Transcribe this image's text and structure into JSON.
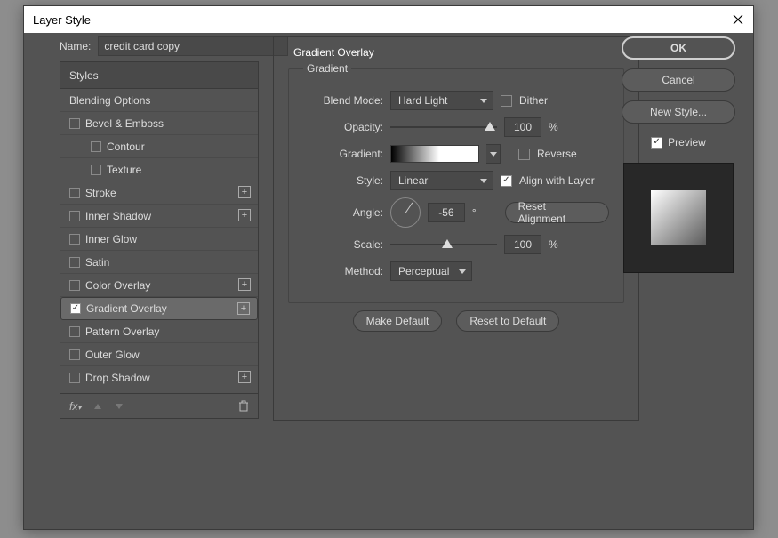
{
  "window": {
    "title": "Layer Style"
  },
  "name": {
    "label": "Name:",
    "value": "credit card copy"
  },
  "styles": {
    "header": "Styles",
    "blending": "Blending Options",
    "items": [
      {
        "label": "Bevel & Emboss",
        "checked": false,
        "add": false
      },
      {
        "label": "Contour",
        "checked": false,
        "add": false
      },
      {
        "label": "Texture",
        "checked": false,
        "add": false
      },
      {
        "label": "Stroke",
        "checked": false,
        "add": true
      },
      {
        "label": "Inner Shadow",
        "checked": false,
        "add": true
      },
      {
        "label": "Inner Glow",
        "checked": false,
        "add": false
      },
      {
        "label": "Satin",
        "checked": false,
        "add": false
      },
      {
        "label": "Color Overlay",
        "checked": false,
        "add": true
      },
      {
        "label": "Gradient Overlay",
        "checked": true,
        "add": true
      },
      {
        "label": "Pattern Overlay",
        "checked": false,
        "add": false
      },
      {
        "label": "Outer Glow",
        "checked": false,
        "add": false
      },
      {
        "label": "Drop Shadow",
        "checked": false,
        "add": true
      }
    ],
    "foot": {
      "fx": "fx",
      "up": "▲",
      "down": "▼",
      "trash": "🗑"
    }
  },
  "center": {
    "title": "Gradient Overlay",
    "legend": "Gradient",
    "blendmode": {
      "label": "Blend Mode:",
      "value": "Hard Light"
    },
    "dither": {
      "label": "Dither",
      "checked": false
    },
    "opacity": {
      "label": "Opacity:",
      "value": "100",
      "unit": "%"
    },
    "gradient": {
      "label": "Gradient:"
    },
    "reverse": {
      "label": "Reverse",
      "checked": false
    },
    "style": {
      "label": "Style:",
      "value": "Linear"
    },
    "align": {
      "label": "Align with Layer",
      "checked": true
    },
    "angle": {
      "label": "Angle:",
      "value": "-56",
      "unit": "°"
    },
    "resetAlign": "Reset Alignment",
    "scale": {
      "label": "Scale:",
      "value": "100",
      "unit": "%"
    },
    "method": {
      "label": "Method:",
      "value": "Perceptual"
    },
    "makeDefault": "Make Default",
    "resetDefault": "Reset to Default"
  },
  "right": {
    "ok": "OK",
    "cancel": "Cancel",
    "newstyle": "New Style...",
    "preview": {
      "label": "Preview",
      "checked": true
    }
  }
}
